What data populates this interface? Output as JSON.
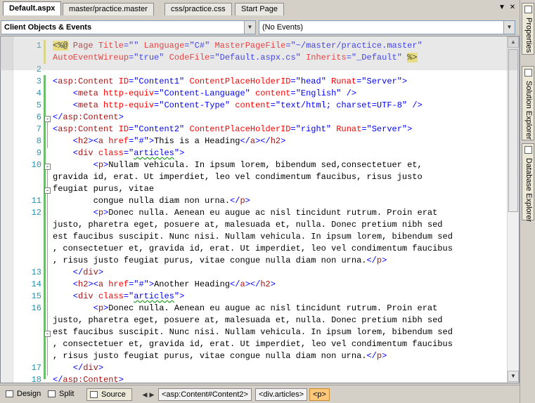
{
  "tabs": [
    {
      "label": "Default.aspx",
      "active": true
    },
    {
      "label": "master/practice.master",
      "active": false
    },
    {
      "label": "css/practice.css",
      "active": false
    },
    {
      "label": "Start Page",
      "active": false
    }
  ],
  "tab_controls": {
    "menu_icon": "▼",
    "close_icon": "✕"
  },
  "dropdowns": {
    "objects": "Client Objects & Events",
    "events": "(No Events)"
  },
  "editor": {
    "gutter_numbers": [
      "1",
      "",
      "2",
      "3",
      "4",
      "5",
      "6",
      "7",
      "8",
      "9",
      "10",
      "",
      "",
      "11",
      "12",
      "",
      "",
      "",
      "",
      "13",
      "14",
      "15",
      "16",
      "",
      "",
      "",
      "",
      "17",
      "18"
    ],
    "lines": [
      [
        {
          "t": "<%@",
          "c": "hl"
        },
        {
          "t": " Page ",
          "c": "k"
        },
        {
          "t": "Title",
          "c": "a"
        },
        {
          "t": "=\"\" ",
          "c": "s"
        },
        {
          "t": "Language",
          "c": "a"
        },
        {
          "t": "=\"C#\" ",
          "c": "s"
        },
        {
          "t": "MasterPageFile",
          "c": "a"
        },
        {
          "t": "=\"~/master/practice.master\"",
          "c": "s"
        }
      ],
      [
        {
          "t": "AutoEventWireup",
          "c": "a"
        },
        {
          "t": "=\"true\" ",
          "c": "s"
        },
        {
          "t": "CodeFile",
          "c": "a"
        },
        {
          "t": "=\"Default.aspx.cs\" ",
          "c": "s"
        },
        {
          "t": "Inherits",
          "c": "a"
        },
        {
          "t": "=\"_Default\" ",
          "c": "s"
        },
        {
          "t": "%>",
          "c": "hl"
        }
      ],
      [],
      [
        {
          "t": "<",
          "c": "b"
        },
        {
          "t": "asp:Content ",
          "c": "k"
        },
        {
          "t": "ID",
          "c": "a"
        },
        {
          "t": "=\"Content1\" ",
          "c": "s"
        },
        {
          "t": "ContentPlaceHolderID",
          "c": "a"
        },
        {
          "t": "=\"head\" ",
          "c": "s"
        },
        {
          "t": "Runat",
          "c": "a"
        },
        {
          "t": "=\"Server\"",
          "c": "s"
        },
        {
          "t": ">",
          "c": "b"
        }
      ],
      [
        {
          "t": "    <",
          "c": "b"
        },
        {
          "t": "meta ",
          "c": "k"
        },
        {
          "t": "http-equiv",
          "c": "a"
        },
        {
          "t": "=\"Content-Language\" ",
          "c": "s"
        },
        {
          "t": "content",
          "c": "a"
        },
        {
          "t": "=\"English\" ",
          "c": "s"
        },
        {
          "t": "/>",
          "c": "b"
        }
      ],
      [
        {
          "t": "    <",
          "c": "b"
        },
        {
          "t": "meta ",
          "c": "k"
        },
        {
          "t": "http-equiv",
          "c": "a"
        },
        {
          "t": "=\"Content-Type\" ",
          "c": "s"
        },
        {
          "t": "content",
          "c": "a"
        },
        {
          "t": "=\"text/html; charset=UTF-8\" ",
          "c": "s"
        },
        {
          "t": "/>",
          "c": "b"
        }
      ],
      [
        {
          "t": "</",
          "c": "b"
        },
        {
          "t": "asp:Content",
          "c": "k"
        },
        {
          "t": ">",
          "c": "b"
        }
      ],
      [
        {
          "t": "<",
          "c": "b"
        },
        {
          "t": "asp:Content ",
          "c": "k"
        },
        {
          "t": "ID",
          "c": "a"
        },
        {
          "t": "=\"Content2\" ",
          "c": "s"
        },
        {
          "t": "ContentPlaceHolderID",
          "c": "a"
        },
        {
          "t": "=\"right\" ",
          "c": "s"
        },
        {
          "t": "Runat",
          "c": "a"
        },
        {
          "t": "=\"Server\"",
          "c": "s"
        },
        {
          "t": ">",
          "c": "b"
        }
      ],
      [
        {
          "t": "    <",
          "c": "b"
        },
        {
          "t": "h2",
          "c": "k"
        },
        {
          "t": "><",
          "c": "b"
        },
        {
          "t": "a ",
          "c": "k"
        },
        {
          "t": "href",
          "c": "a"
        },
        {
          "t": "=\"#\"",
          "c": "s"
        },
        {
          "t": ">",
          "c": "b"
        },
        {
          "t": "This is a Heading",
          "c": "t"
        },
        {
          "t": "</",
          "c": "b"
        },
        {
          "t": "a",
          "c": "k"
        },
        {
          "t": "></",
          "c": "b"
        },
        {
          "t": "h2",
          "c": "k"
        },
        {
          "t": ">",
          "c": "b"
        }
      ],
      [
        {
          "t": "    <",
          "c": "b"
        },
        {
          "t": "div ",
          "c": "k"
        },
        {
          "t": "class",
          "c": "a"
        },
        {
          "t": "=\"",
          "c": "s"
        },
        {
          "t": "articles",
          "c": "s wav"
        },
        {
          "t": "\"",
          "c": "s"
        },
        {
          "t": ">",
          "c": "b"
        }
      ],
      [
        {
          "t": "        <",
          "c": "b"
        },
        {
          "t": "p",
          "c": "k"
        },
        {
          "t": ">",
          "c": "b"
        },
        {
          "t": "Nullam vehicula. In ipsum lorem, bibendum sed,consectetuer et,",
          "c": "t"
        }
      ],
      [
        {
          "t": "gravida id, erat. Ut imperdiet, leo vel condimentum faucibus, risus justo",
          "c": "t"
        }
      ],
      [
        {
          "t": "feugiat purus, vitae",
          "c": "t"
        }
      ],
      [
        {
          "t": "        congue nulla diam non urna.",
          "c": "t"
        },
        {
          "t": "</",
          "c": "b"
        },
        {
          "t": "p",
          "c": "k"
        },
        {
          "t": ">",
          "c": "b"
        }
      ],
      [
        {
          "t": "        <",
          "c": "b"
        },
        {
          "t": "p",
          "c": "k"
        },
        {
          "t": ">",
          "c": "b"
        },
        {
          "t": "Donec nulla. Aenean eu augue ac nisl tincidunt rutrum. Proin erat",
          "c": "t"
        }
      ],
      [
        {
          "t": "justo, pharetra eget, posuere at, malesuada et, nulla. Donec pretium nibh sed",
          "c": "t"
        }
      ],
      [
        {
          "t": "est faucibus suscipit. Nunc nisi. Nullam vehicula. In ipsum lorem, bibendum sed",
          "c": "t"
        }
      ],
      [
        {
          "t": ", consectetuer et, gravida id, erat. Ut imperdiet, leo vel condimentum faucibus",
          "c": "t"
        }
      ],
      [
        {
          "t": ", risus justo feugiat purus, vitae congue nulla diam non urna.",
          "c": "t"
        },
        {
          "t": "</",
          "c": "b"
        },
        {
          "t": "p",
          "c": "k"
        },
        {
          "t": ">",
          "c": "b"
        }
      ],
      [
        {
          "t": "    </",
          "c": "b"
        },
        {
          "t": "div",
          "c": "k"
        },
        {
          "t": ">",
          "c": "b"
        }
      ],
      [
        {
          "t": "    <",
          "c": "b"
        },
        {
          "t": "h2",
          "c": "k"
        },
        {
          "t": "><",
          "c": "b"
        },
        {
          "t": "a ",
          "c": "k"
        },
        {
          "t": "href",
          "c": "a"
        },
        {
          "t": "=\"#\"",
          "c": "s"
        },
        {
          "t": ">",
          "c": "b"
        },
        {
          "t": "Another Heading",
          "c": "t"
        },
        {
          "t": "</",
          "c": "b"
        },
        {
          "t": "a",
          "c": "k"
        },
        {
          "t": "></",
          "c": "b"
        },
        {
          "t": "h2",
          "c": "k"
        },
        {
          "t": ">",
          "c": "b"
        }
      ],
      [
        {
          "t": "    <",
          "c": "b"
        },
        {
          "t": "div ",
          "c": "k"
        },
        {
          "t": "class",
          "c": "a"
        },
        {
          "t": "=\"",
          "c": "s"
        },
        {
          "t": "articles",
          "c": "s wav"
        },
        {
          "t": "\"",
          "c": "s"
        },
        {
          "t": ">",
          "c": "b"
        }
      ],
      [
        {
          "t": "        <",
          "c": "b"
        },
        {
          "t": "p",
          "c": "k"
        },
        {
          "t": ">",
          "c": "b"
        },
        {
          "t": "Donec nulla. Aenean eu augue ac nisl tincidunt rutrum. Proin erat",
          "c": "t"
        }
      ],
      [
        {
          "t": "justo, pharetra eget, posuere at, malesuada et, nulla. Donec pretium nibh sed",
          "c": "t"
        }
      ],
      [
        {
          "t": "est faucibus suscipit. Nunc nisi. Nullam vehicula. In ipsum lorem, bibendum sed",
          "c": "t"
        }
      ],
      [
        {
          "t": ", consectetuer et, gravida id, erat. Ut imperdiet, leo vel condimentum faucibus",
          "c": "t"
        }
      ],
      [
        {
          "t": ", risus justo feugiat purus, vitae congue nulla diam non urna.",
          "c": "t"
        },
        {
          "t": "</",
          "c": "b"
        },
        {
          "t": "p",
          "c": "k"
        },
        {
          "t": ">",
          "c": "b"
        }
      ],
      [
        {
          "t": "    </",
          "c": "b"
        },
        {
          "t": "div",
          "c": "k"
        },
        {
          "t": ">",
          "c": "b"
        }
      ],
      [
        {
          "t": "</",
          "c": "b"
        },
        {
          "t": "asp:Content",
          "c": "k"
        },
        {
          "t": ">",
          "c": "b"
        }
      ]
    ]
  },
  "bottombar": {
    "views": [
      {
        "label": "Design",
        "selected": false
      },
      {
        "label": "Split",
        "selected": false
      },
      {
        "label": "Source",
        "selected": true
      }
    ],
    "breadcrumbs": [
      {
        "label": "<asp:Content#Content2>",
        "current": false
      },
      {
        "label": "<div.articles>",
        "current": false
      },
      {
        "label": "<p>",
        "current": true
      }
    ]
  },
  "dock_tabs": [
    "Properties",
    "Solution Explorer",
    "Database Explorer"
  ]
}
